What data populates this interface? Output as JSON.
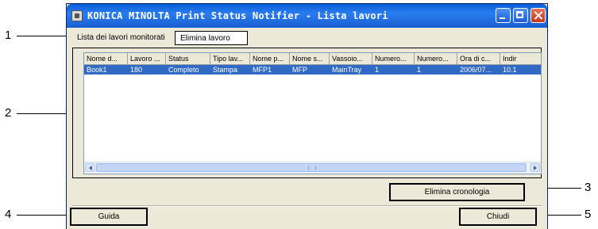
{
  "callouts": [
    "1",
    "2",
    "3",
    "4",
    "5"
  ],
  "window": {
    "title": "KONICA MINOLTA Print Status Notifier - Lista lavori"
  },
  "tabs": [
    {
      "label": "Lista dei lavori monitorati"
    },
    {
      "label": "Elimina lavoro"
    }
  ],
  "columns": [
    "Nome d...",
    "Lavoro ...",
    "Status",
    "Tipo lav...",
    "Nome p...",
    "Nome s...",
    "Vassoio...",
    "Numero...",
    "Numero...",
    "Ora di c...",
    "Indir"
  ],
  "rows": [
    [
      "Book1",
      "180",
      "Completo",
      "Stampa",
      "MFP1",
      "MFP",
      "MainTray",
      "1",
      "1",
      "2006/07...",
      "10.1"
    ]
  ],
  "buttons": {
    "cronologia": "Elimina cronologia",
    "guida": "Guida",
    "chiudi": "Chiudi"
  },
  "colors": {
    "titlebar": "#0a5fd8",
    "selection": "#316ac5",
    "face": "#ece9d8"
  }
}
